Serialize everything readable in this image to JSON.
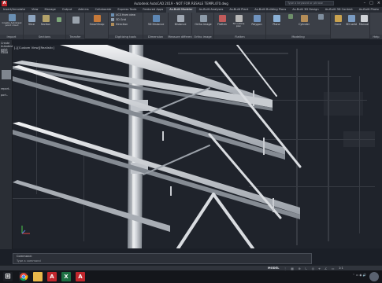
{
  "window": {
    "title": "Autodesk AutoCAD 2019 - NOT FOR RESALE   TEMPL470.dwg",
    "search_placeholder": "Type a keyword or phrase"
  },
  "tabs": [
    "Insert/Annotate",
    "View",
    "Manage",
    "Output",
    "Add-ins",
    "Collaborate",
    "Express Tools",
    "Featured Apps",
    "As-Built Modeler",
    "As-Built Analyses",
    "As-Built Plant",
    "As-Built Building Plans",
    "As-Built 3D Design",
    "As-Built 3D Context",
    "As-Built Photo",
    "As-Built Feature Data"
  ],
  "active_tab": "As-Built Modeler",
  "ribbon": {
    "import": {
      "label": "Import",
      "button": "Create Autodesk point cloud"
    },
    "sections": {
      "label": "Sections",
      "buttons": [
        "Slice",
        "Section"
      ]
    },
    "transfer": {
      "label": "Transfer"
    },
    "smartsnap": {
      "label": "SmartSnap"
    },
    "digitizing": {
      "label": "Digitizing tools",
      "items": [
        "UCS from view",
        "3D Grid",
        "Direction"
      ]
    },
    "dimension": {
      "label": "Dimension",
      "button": "3D Distance"
    },
    "measure": {
      "label": "Measure differences",
      "button": "Distance"
    },
    "ortho": {
      "label": "Ortho image",
      "button": "Ortho image"
    },
    "flatten": {
      "label": "Flatten",
      "buttons": [
        "Flatten",
        "Fit outline plan",
        "Polygon"
      ]
    },
    "modeling": {
      "label": "Modeling",
      "buttons": [
        "Plane",
        "Cylinder"
      ]
    },
    "fit": {
      "label": "Fit",
      "buttons": [
        "Cone",
        "3D solid",
        "Manual"
      ]
    },
    "help": {
      "label": "Help"
    }
  },
  "palette": {
    "items": [
      "Create Autodesk point cloud",
      "point",
      "report..",
      "port.."
    ]
  },
  "viewport": {
    "label": "[-][Custom View][Realistic]"
  },
  "command": {
    "history": "Command:",
    "prompt": "Type a command"
  },
  "status": {
    "model": "MODEL",
    "scale": "1:1"
  },
  "taskbar": {
    "apps": [
      "start",
      "chrome",
      "explorer",
      "autocad",
      "excel",
      "autocad2"
    ]
  },
  "colors": {
    "viewport_bg": "#1f232b",
    "ribbon_bg": "#3b3f47",
    "autocad_red": "#c1272d",
    "excel_green": "#1d6f42"
  }
}
